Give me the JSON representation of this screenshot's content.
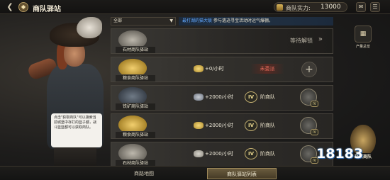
{
  "header": {
    "title": "商队驿站",
    "title_icon": "caravan-emblem-icon",
    "strength_label": "商队实力:",
    "strength_value": "13000",
    "back_icon": "back-arrow-icon"
  },
  "character": {
    "tip": "点击\"获取商队\"可以接索当前城堡中存打的篮子都，战斗篮篮都可以获取商队。"
  },
  "filter": {
    "selected": "全部",
    "notice_highlight": "最打湖的猫大联",
    "notice_rest": "参与遗迹寻宝活动时运气爆棚。"
  },
  "rows": [
    {
      "name": "石材商队驿站",
      "icon": "stone-icon",
      "state": "locked",
      "locked_text": "等待解锁",
      "locked_chevron": "»"
    },
    {
      "name": "粮食商队驿站",
      "icon": "grain-icon",
      "state": "unassigned",
      "rate": "+0/小时",
      "status": "未委派",
      "add_symbol": "+"
    },
    {
      "name": "铁矿商队驿站",
      "icon": "ore-icon",
      "state": "assigned",
      "rate": "+2000/小时",
      "rank": "IV",
      "rank_label": "阶商队",
      "leader_tier": "IV"
    },
    {
      "name": "粮食商队驿站",
      "icon": "grain-icon",
      "state": "assigned",
      "rate": "+2000/小时",
      "rank": "IV",
      "rank_label": "阶商队",
      "leader_tier": "IV"
    },
    {
      "name": "石材商队驿站",
      "icon": "stone-icon",
      "state": "assigned",
      "rate": "+2000/小时",
      "rank": "IV",
      "rank_label": "阶商队",
      "leader_tier": "IV"
    }
  ],
  "side": {
    "output_label": "产量总览",
    "acquire_label": "获取商队",
    "watermark": "18183"
  },
  "tabs": [
    {
      "label": "商路地图",
      "active": false
    },
    {
      "label": "商队驿站列表",
      "active": true
    }
  ]
}
